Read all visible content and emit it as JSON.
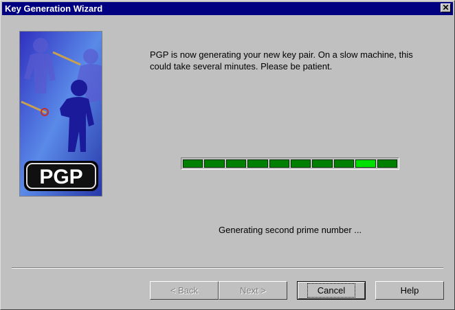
{
  "window": {
    "title": "Key Generation Wizard",
    "close_glyph": "✕"
  },
  "side_image": {
    "logo_text": "PGP"
  },
  "message": "PGP is now generating your new key pair.  On a slow machine, this could take several minutes.  Please be patient.",
  "progress": {
    "segments": 10,
    "highlighted_segment": 9
  },
  "status": "Generating second prime number ...",
  "buttons": {
    "back": "< Back",
    "next": "Next >",
    "cancel": "Cancel",
    "help": "Help"
  },
  "colors": {
    "titlebar": "#000080",
    "progress_fill": "#008000",
    "progress_highlight": "#00e000"
  }
}
